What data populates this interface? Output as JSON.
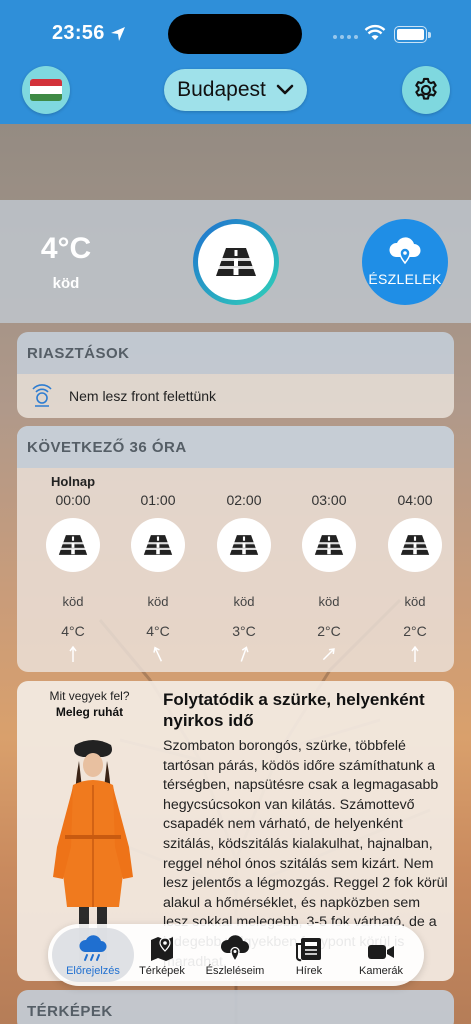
{
  "status": {
    "time": "23:56"
  },
  "header": {
    "city": "Budapest"
  },
  "current": {
    "temperature": "4°C",
    "condition": "köd",
    "report_label": "ÉSZLELEK"
  },
  "alerts": {
    "title": "RIASZTÁSOK",
    "message": "Nem lesz front felettünk"
  },
  "forecast": {
    "title": "KÖVETKEZŐ 36 ÓRA",
    "day_label": "Holnap",
    "hours": [
      {
        "time": "00:00",
        "condition": "köd",
        "temp": "4°C"
      },
      {
        "time": "01:00",
        "condition": "köd",
        "temp": "4°C"
      },
      {
        "time": "02:00",
        "condition": "köd",
        "temp": "3°C"
      },
      {
        "time": "03:00",
        "condition": "köd",
        "temp": "2°C"
      },
      {
        "time": "04:00",
        "condition": "köd",
        "temp": "2°C"
      }
    ]
  },
  "article": {
    "advice_question": "Mit vegyek fel?",
    "advice_answer": "Meleg ruhát",
    "title": "Folytatódik a szürke, helyenként nyirkos idő",
    "text": "Szombaton borongós, szürke, többfelé tartósan párás, ködös időre számíthatunk a térségben, napsütésre csak a legmagasabb hegycsúcsokon van kilátás. Számottevő csapadék nem várható, de helyenként szitálás, ködszitálás kialakulhat, hajnalban, reggel néhol ónos szitálás sem kizárt. Nem lesz jelentős a légmozgás. Reggel 2 fok körül alakul a hőmérséklet, és napközben sem lesz sokkal melegebb, 3-5 fok várható, de a hidegebb völgyekben fagypont körül is maradhat."
  },
  "tabs": [
    {
      "label": "Előrejelzés",
      "icon": "cloud-icon"
    },
    {
      "label": "Térképek",
      "icon": "map-icon"
    },
    {
      "label": "Észleléseim",
      "icon": "location-cloud-icon"
    },
    {
      "label": "Hírek",
      "icon": "newspaper-icon"
    },
    {
      "label": "Kamerák",
      "icon": "camera-icon"
    }
  ],
  "maps": {
    "title": "TÉRKÉPEK"
  },
  "colors": {
    "header_blue": "#2f8fd9",
    "accent_cyan": "#7fd8df",
    "active_tab": "#1f6fd0"
  }
}
